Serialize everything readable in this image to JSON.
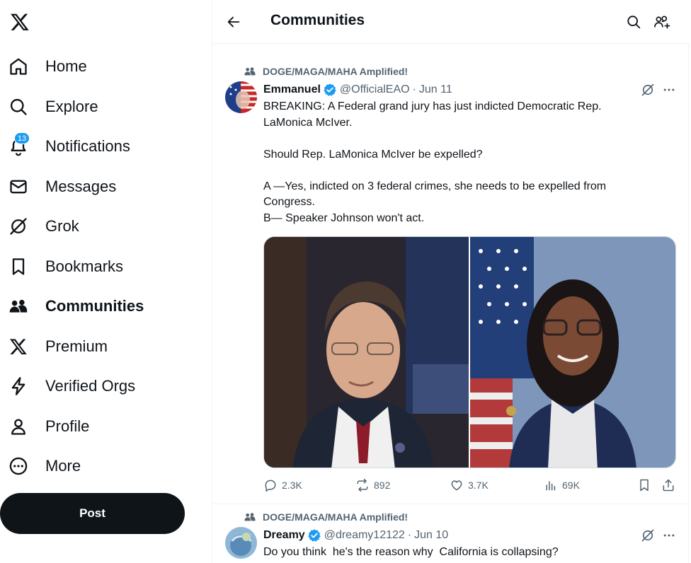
{
  "sidebar": {
    "logo": "x-logo-icon",
    "items": [
      {
        "label": "Home",
        "icon": "home-icon"
      },
      {
        "label": "Explore",
        "icon": "search-icon"
      },
      {
        "label": "Notifications",
        "icon": "bell-icon",
        "badge": "13"
      },
      {
        "label": "Messages",
        "icon": "envelope-icon"
      },
      {
        "label": "Grok",
        "icon": "grok-icon"
      },
      {
        "label": "Bookmarks",
        "icon": "bookmark-icon"
      },
      {
        "label": "Communities",
        "icon": "communities-icon",
        "active": true
      },
      {
        "label": "Premium",
        "icon": "x-logo-icon"
      },
      {
        "label": "Verified Orgs",
        "icon": "lightning-icon"
      },
      {
        "label": "Profile",
        "icon": "person-icon"
      },
      {
        "label": "More",
        "icon": "more-circle-icon"
      }
    ],
    "post_button": "Post"
  },
  "header": {
    "title": "Communities"
  },
  "posts": [
    {
      "community": "DOGE/MAGA/MAHA Amplified!",
      "name": "Emmanuel",
      "handle": "@OfficialEAO",
      "separator": "·",
      "date": "Jun 11",
      "lines": [
        "BREAKING: A Federal grand jury has just indicted Democratic Rep.",
        "LaMonica McIver.",
        "",
        "Should Rep. LaMonica McIver be expelled?",
        "",
        "A —Yes, indicted on 3 federal crimes, she needs to be expelled from",
        "Congress.",
        "B— Speaker Johnson won't act."
      ],
      "stats": {
        "replies": "2.3K",
        "reposts": "892",
        "likes": "3.7K",
        "views": "69K"
      }
    },
    {
      "community": "DOGE/MAGA/MAHA Amplified!",
      "name": "Dreamy",
      "handle": "@dreamy12122",
      "separator": "·",
      "date": "Jun 10",
      "text": "Do you think  he's the reason why  California is collapsing?"
    }
  ],
  "colors": {
    "text": "#0f1419",
    "secondary": "#536471",
    "accent": "#1d9bf0",
    "border": "#eff3f4"
  }
}
